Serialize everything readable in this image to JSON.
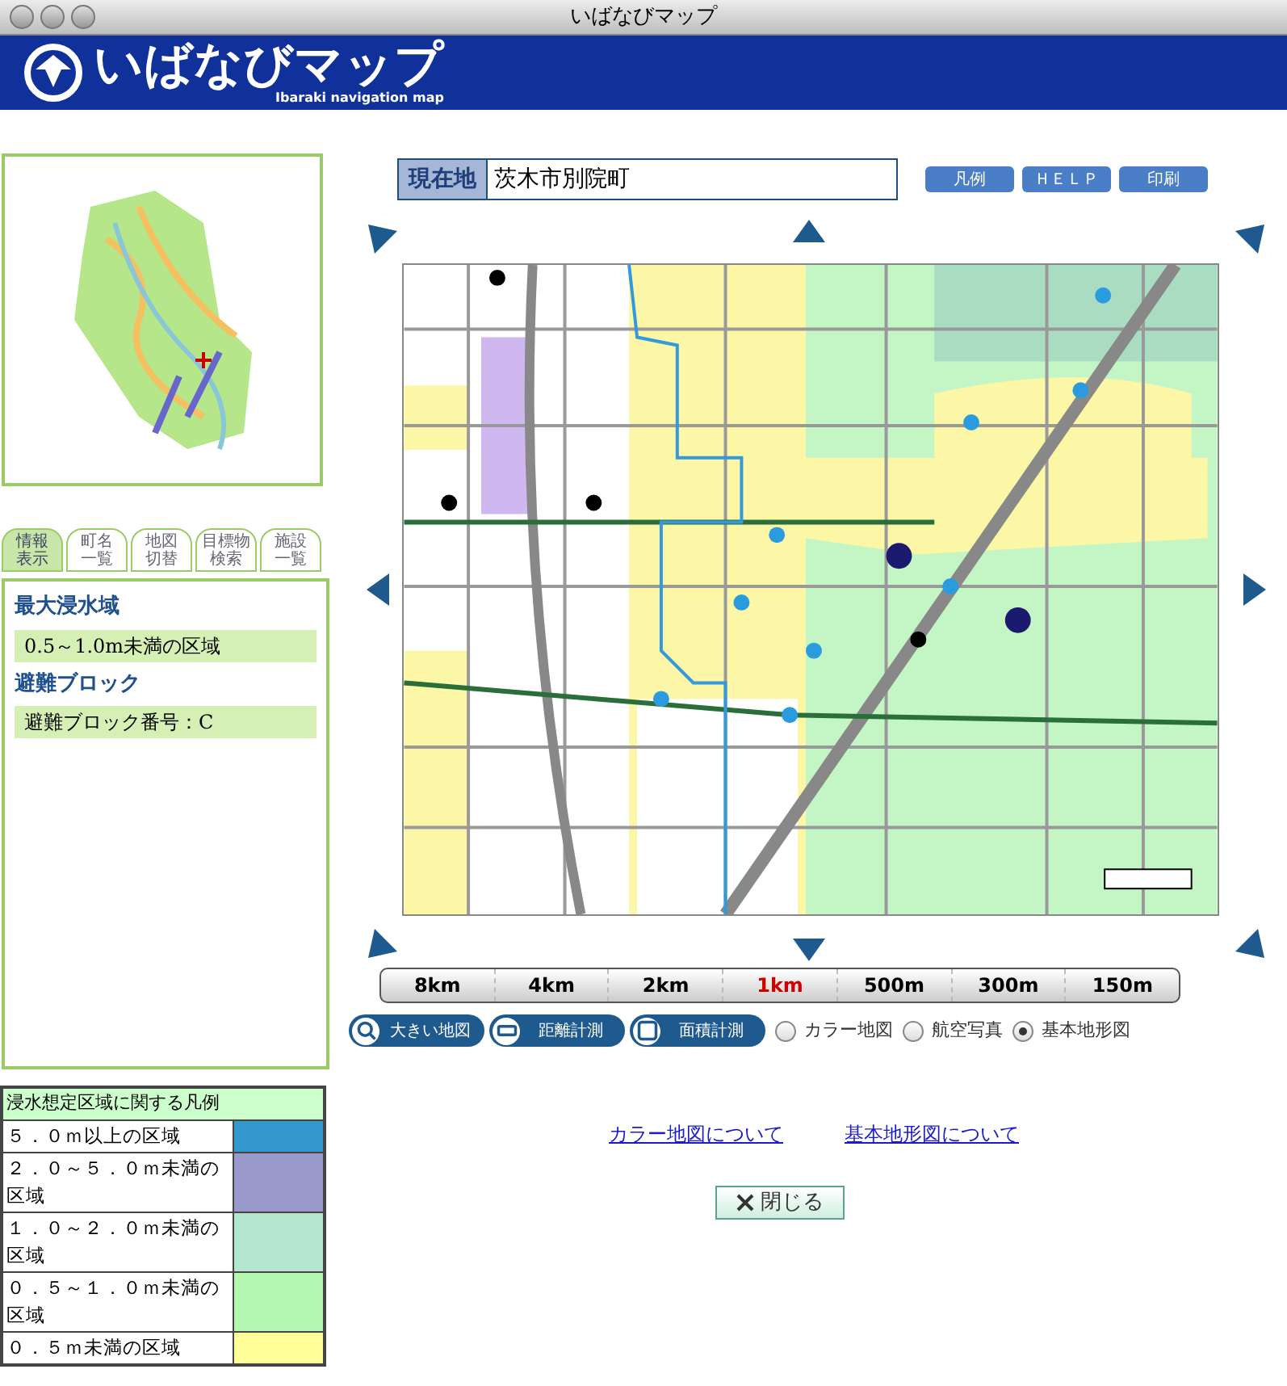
{
  "window": {
    "title": "いばなびマップ"
  },
  "header": {
    "title": "いばなびマップ",
    "subtitle": "Ibaraki navigation map"
  },
  "location": {
    "label": "現在地",
    "value": "茨木市別院町"
  },
  "top_buttons": [
    "凡例",
    "ＨＥＬＰ",
    "印刷"
  ],
  "tabs": [
    {
      "label": "情報表示",
      "selected": true
    },
    {
      "label": "町名一覧",
      "selected": false
    },
    {
      "label": "地図切替",
      "selected": false
    },
    {
      "label": "目標物検索",
      "selected": false
    },
    {
      "label": "施設一覧",
      "selected": false
    }
  ],
  "info": [
    {
      "heading": "最大浸水域",
      "value": "0.5～1.0m未満の区域"
    },
    {
      "heading": "避難ブロック",
      "value": "避難ブロック番号：C"
    }
  ],
  "legend": {
    "title": "浸水想定区域に関する凡例",
    "rows": [
      {
        "label": "５．０ｍ以上の区域",
        "color": "#3399cc"
      },
      {
        "label": "２．０～５．０ｍ未満の区域",
        "color": "#9999cc"
      },
      {
        "label": "１．０～２．０ｍ未満の区域",
        "color": "#b3e6cc"
      },
      {
        "label": "０．５～１．０ｍ未満の区域",
        "color": "#b3f7b3"
      },
      {
        "label": "０．５ｍ未満の区域",
        "color": "#ffff99"
      }
    ]
  },
  "scale_bar": [
    {
      "label": "8km",
      "selected": false
    },
    {
      "label": "4km",
      "selected": false
    },
    {
      "label": "2km",
      "selected": false
    },
    {
      "label": "1km",
      "selected": true
    },
    {
      "label": "500m",
      "selected": false
    },
    {
      "label": "300m",
      "selected": false
    },
    {
      "label": "150m",
      "selected": false
    }
  ],
  "tools": [
    {
      "label": "大きい地図",
      "kind": "zoom"
    },
    {
      "label": "距離計測",
      "kind": "distance"
    },
    {
      "label": "面積計測",
      "kind": "area"
    }
  ],
  "map_types": [
    {
      "label": "カラー地図",
      "selected": false
    },
    {
      "label": "航空写真",
      "selected": false
    },
    {
      "label": "基本地形図",
      "selected": true
    }
  ],
  "links": [
    "カラー地図について",
    "基本地形図について"
  ],
  "close_button": "閉じる"
}
